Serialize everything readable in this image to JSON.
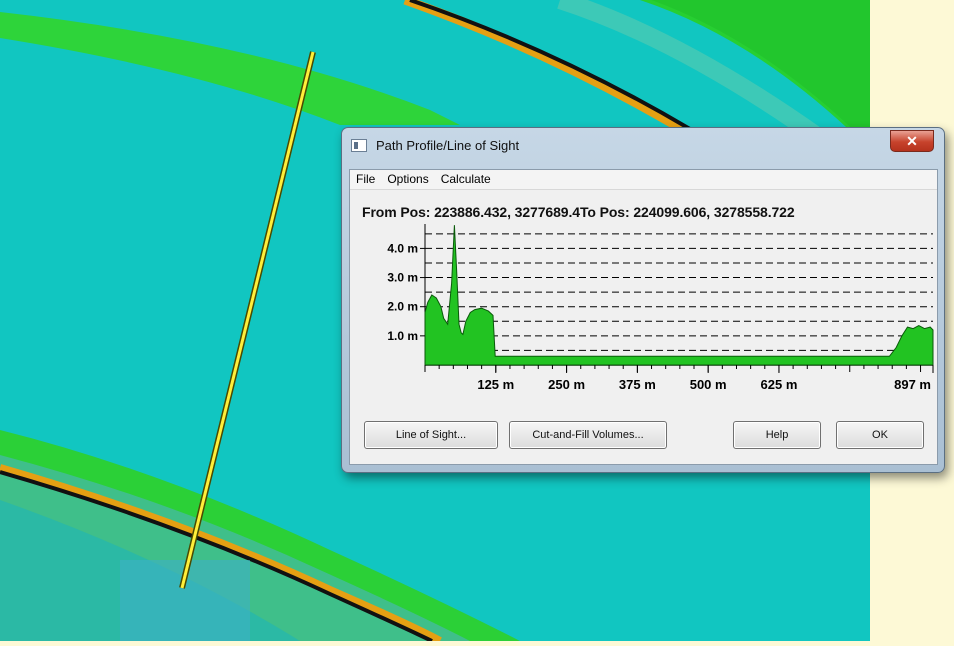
{
  "dialog": {
    "title": "Path Profile/Line of Sight",
    "close_glyph": "✕",
    "menu": [
      "File",
      "Options",
      "Calculate"
    ],
    "from_label": "From Pos:",
    "from_value": "223886.432, 3277689.4",
    "to_label": "To Pos:",
    "to_value": "224099.606, 3278558.722",
    "buttons": {
      "line_of_sight": "Line of Sight...",
      "cut_fill": "Cut-and-Fill Volumes...",
      "help": "Help",
      "ok": "OK"
    }
  },
  "chart_data": {
    "type": "area",
    "xlim": [
      0,
      897
    ],
    "ylim": [
      0,
      4.7
    ],
    "y_ticks": [
      {
        "label": "1.0 m",
        "value": 1.0
      },
      {
        "label": "2.0 m",
        "value": 2.0
      },
      {
        "label": "3.0 m",
        "value": 3.0
      },
      {
        "label": "4.0 m",
        "value": 4.0
      }
    ],
    "x_ticks": [
      {
        "label": "125 m",
        "value": 125
      },
      {
        "label": "250 m",
        "value": 250
      },
      {
        "label": "375 m",
        "value": 375
      },
      {
        "label": "500 m",
        "value": 500
      },
      {
        "label": "625 m",
        "value": 625
      },
      {
        "label": "897 m",
        "value": 897
      }
    ],
    "grid_y": [
      0.5,
      1.0,
      1.5,
      2.0,
      2.5,
      3.0,
      3.5,
      4.0,
      4.5
    ],
    "fill_color": "#22c322",
    "profile": [
      [
        0,
        1.8
      ],
      [
        5,
        2.15
      ],
      [
        12,
        2.4
      ],
      [
        20,
        2.3
      ],
      [
        28,
        2.0
      ],
      [
        33,
        1.6
      ],
      [
        40,
        1.4
      ],
      [
        47,
        2.8
      ],
      [
        52,
        4.8
      ],
      [
        56,
        3.2
      ],
      [
        60,
        1.4
      ],
      [
        64,
        1.1
      ],
      [
        67,
        1.05
      ],
      [
        72,
        1.5
      ],
      [
        80,
        1.8
      ],
      [
        88,
        1.9
      ],
      [
        100,
        1.95
      ],
      [
        112,
        1.85
      ],
      [
        120,
        1.7
      ],
      [
        124,
        0.3
      ],
      [
        820,
        0.3
      ],
      [
        832,
        0.6
      ],
      [
        842,
        1.0
      ],
      [
        852,
        1.3
      ],
      [
        862,
        1.25
      ],
      [
        872,
        1.35
      ],
      [
        882,
        1.25
      ],
      [
        892,
        1.3
      ],
      [
        897,
        1.2
      ]
    ]
  },
  "map": {
    "water_color": "#11c6c1",
    "bank_color": "#27cf32",
    "side_panel_color": "#fdf9d6"
  }
}
